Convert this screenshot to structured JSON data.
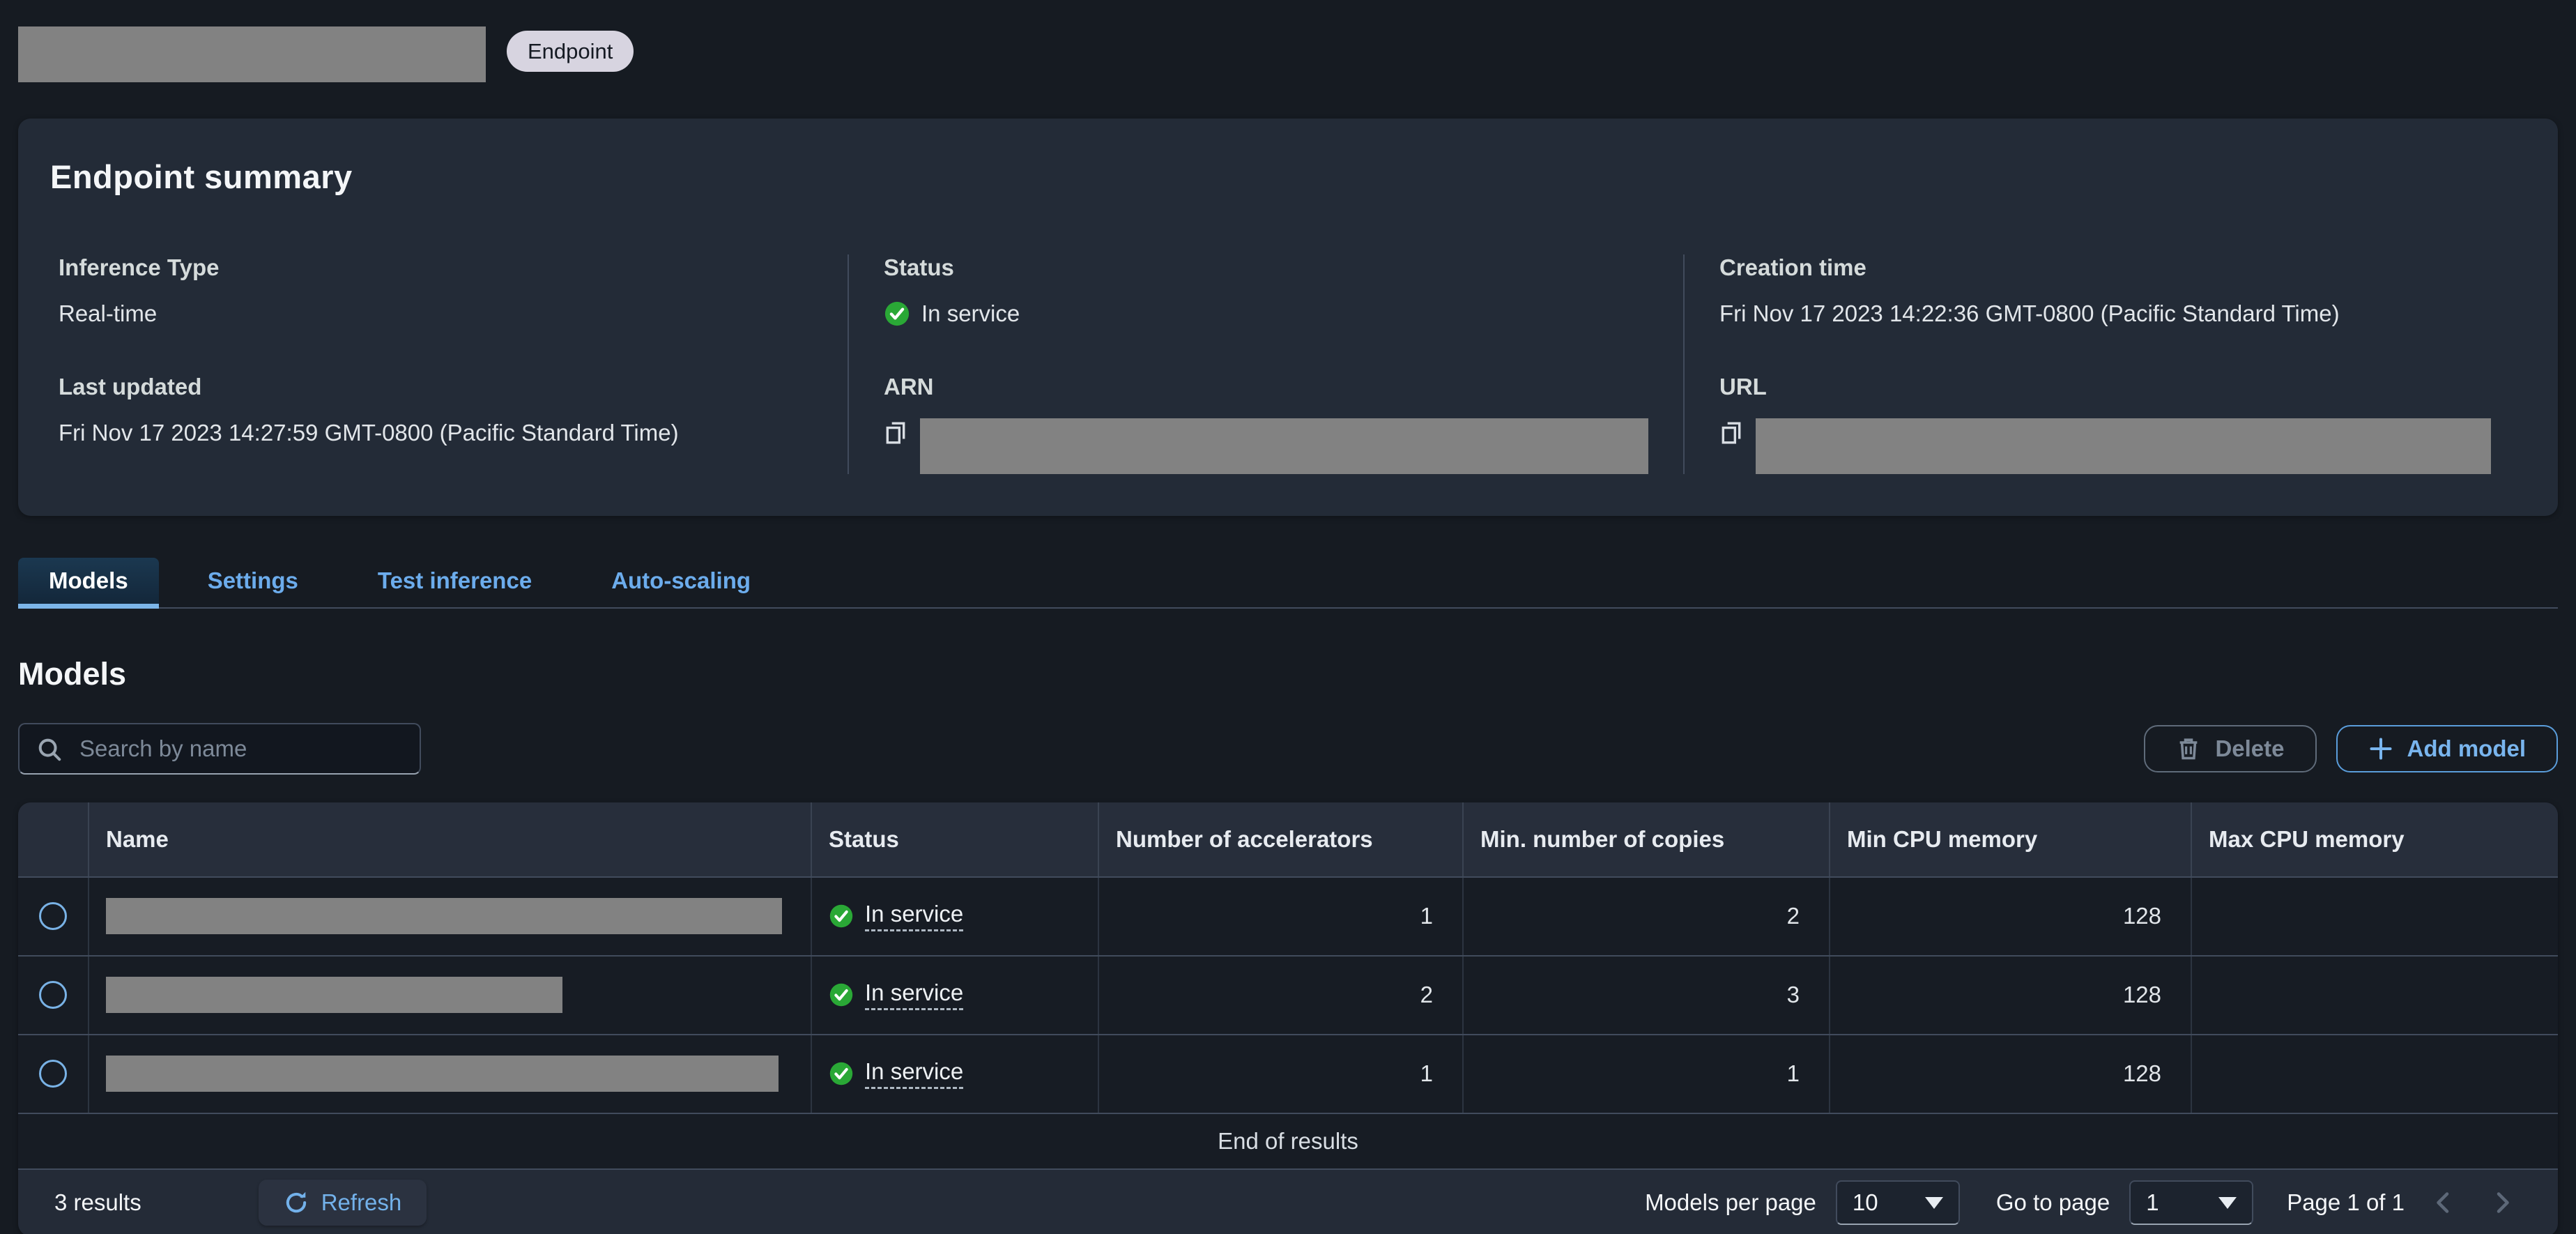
{
  "header": {
    "badge": "Endpoint",
    "title_redacted": true
  },
  "summary": {
    "title": "Endpoint summary",
    "inference_type": {
      "label": "Inference Type",
      "value": "Real-time"
    },
    "status": {
      "label": "Status",
      "value": "In service"
    },
    "creation_time": {
      "label": "Creation time",
      "value": "Fri Nov 17 2023 14:22:36 GMT-0800 (Pacific Standard Time)"
    },
    "last_updated": {
      "label": "Last updated",
      "value": "Fri Nov 17 2023 14:27:59 GMT-0800 (Pacific Standard Time)"
    },
    "arn": {
      "label": "ARN",
      "value_redacted": true
    },
    "url": {
      "label": "URL",
      "value_redacted": true
    }
  },
  "tabs": {
    "active": "Models",
    "items": [
      {
        "label": "Models"
      },
      {
        "label": "Settings"
      },
      {
        "label": "Test inference"
      },
      {
        "label": "Auto-scaling"
      }
    ]
  },
  "models": {
    "heading": "Models",
    "search_placeholder": "Search by name",
    "delete_label": "Delete",
    "add_label": "Add model",
    "table": {
      "columns": [
        "Name",
        "Status",
        "Number of accelerators",
        "Min. number of copies",
        "Min CPU memory",
        "Max CPU memory"
      ],
      "rows": [
        {
          "name_redacted": true,
          "status": "In service",
          "accelerators": "1",
          "min_copies": "2",
          "min_cpu": "128",
          "max_cpu": ""
        },
        {
          "name_redacted": true,
          "status": "In service",
          "accelerators": "2",
          "min_copies": "3",
          "min_cpu": "128",
          "max_cpu": ""
        },
        {
          "name_redacted": true,
          "status": "In service",
          "accelerators": "1",
          "min_copies": "1",
          "min_cpu": "128",
          "max_cpu": ""
        }
      ],
      "end_text": "End of results"
    },
    "footer": {
      "results": "3 results",
      "refresh_label": "Refresh",
      "per_page_label": "Models per page",
      "per_page_value": "10",
      "goto_label": "Go to page",
      "goto_value": "1",
      "page_text": "Page 1 of 1"
    }
  },
  "colors": {
    "page_bg": "#161b22",
    "panel_bg": "#232b37",
    "table_header_bg": "#272e3b",
    "accent_blue": "#6cacec",
    "success_green": "#2aa836",
    "redaction_gray": "#828282",
    "badge_bg": "#d7d4e0",
    "border": "#414b5c",
    "disabled_text": "#7d8998"
  }
}
